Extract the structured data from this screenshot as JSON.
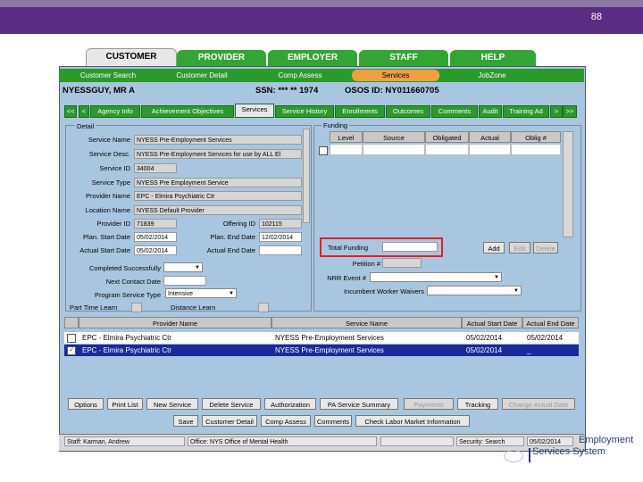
{
  "slide_number": "88",
  "main_tabs": [
    "CUSTOMER",
    "PROVIDER",
    "EMPLOYER",
    "STAFF",
    "HELP"
  ],
  "sub_tabs": [
    "Customer Search",
    "Customer Detail",
    "Comp Assess",
    "Services",
    "JobZone"
  ],
  "header": {
    "name": "NYESSGUY, MR A",
    "ssn": "SSN: *** ** 1974",
    "osos": "OSOS ID: NY011660705"
  },
  "section_tabs": [
    "<<",
    "<",
    "Agency Info",
    "Achievement Objectives",
    "Services",
    "Service History",
    "Enrollments",
    "Outcomes",
    "Comments",
    "Audit",
    "Training Ad",
    ">",
    ">>"
  ],
  "detail": {
    "title": "Detail",
    "labels": {
      "service_name": "Service Name",
      "service_desc": "Service Desc.",
      "service_id": "Service ID",
      "service_type": "Service Type",
      "provider_name": "Provider Name",
      "location_name": "Location Name",
      "provider_id": "Provider ID",
      "offering_id": "Offering ID",
      "plan_start": "Plan. Start Date",
      "plan_end": "Plan. End Date",
      "actual_start": "Actual Start Date",
      "actual_end": "Actual End Date",
      "completed": "Completed Successfully",
      "next_contact": "Next Contact Date",
      "program_type": "Program Service Type",
      "part_time": "Part Time Learn",
      "distance": "Distance Learn"
    },
    "values": {
      "service_name": "NYESS Pre-Employment Services",
      "service_desc": "NYESS Pre-Employment Services for use by ALL El",
      "service_id": "34004",
      "service_type": "NYESS Pre Employment Service",
      "provider_name": "EPC - Elmira Psychiatric Ctr",
      "location_name": "NYESS Default Provider",
      "provider_id": "71839",
      "offering_id": "102115",
      "plan_start": "05/02/2014",
      "plan_end": "12/02/2014",
      "actual_start": "05/02/2014",
      "program_type": "Intensive"
    }
  },
  "funding": {
    "title": "Funding",
    "columns": [
      "Level",
      "Source",
      "Obligated",
      "Actual",
      "Oblig #"
    ],
    "total_label": "Total Funding",
    "buttons": [
      "Add",
      "Edit",
      "Delete"
    ],
    "petition_label": "Petition #",
    "nrr_label": "NRR Event #",
    "incumbent_label": "Incumbent Worker Waivers"
  },
  "table": {
    "columns": [
      "Provider Name",
      "Service Name",
      "Actual Start Date",
      "Actual End Date"
    ],
    "rows": [
      {
        "checked": false,
        "provider": "EPC - Elmira Psychiatric Ctr",
        "service": "NYESS Pre-Employment Services",
        "start": "05/02/2014",
        "end": "05/02/2014"
      },
      {
        "checked": true,
        "provider": "EPC - Elmira Psychiatric Ctr",
        "service": "NYESS Pre-Employment Services",
        "start": "05/02/2014",
        "end": "_"
      }
    ]
  },
  "action_buttons": [
    "Options",
    "Print List",
    "New Service",
    "Delete Service",
    "Authorization",
    "PA Service Summary",
    "Payments",
    "Tracking",
    "Change Actual Date"
  ],
  "bottom_buttons": [
    "Save",
    "Customer Detail",
    "Comp Assess",
    "Comments",
    "Check Labor Market Information"
  ],
  "status": {
    "staff": "Staff: Karman, Andrew",
    "office": "Office: NYS Office of Mental Health",
    "security": "Security: Search",
    "date": "05/02/2014"
  },
  "logo": {
    "line1": "Employment",
    "line2": "Services System"
  },
  "colors": {
    "purple": "#5b2d82",
    "green": "#2a9a2a",
    "highlight": "#e02020",
    "selected_row": "#1a2a9a"
  }
}
